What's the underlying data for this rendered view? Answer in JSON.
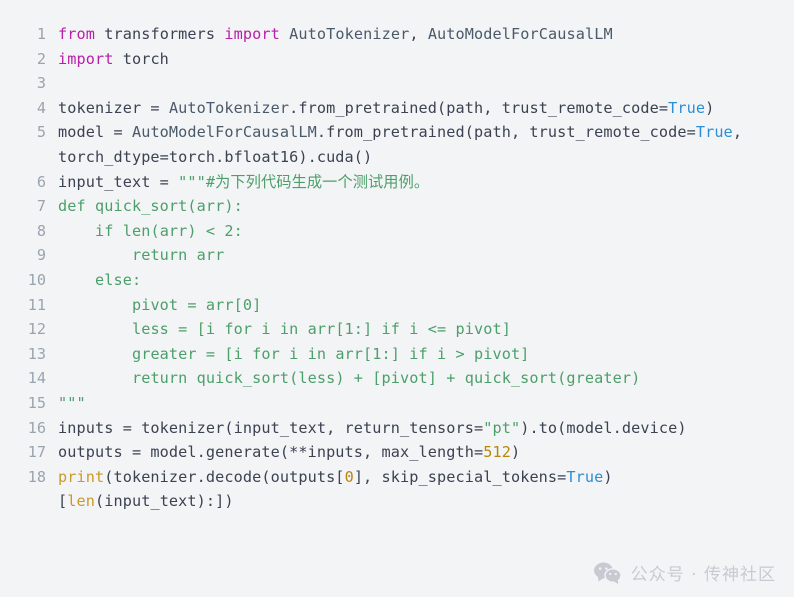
{
  "editor": {
    "language": "python",
    "background_color": "#f3f4f6",
    "gutter_color": "#9aa4ae",
    "default_text_color": "#3b4252",
    "colors": {
      "keyword": "#b820a8",
      "identifier": "#4a5a6a",
      "constant": "#2a8fd4",
      "string": "#4c9f6a",
      "number": "#b8860b",
      "builtin": "#ca9a24"
    },
    "lines": [
      {
        "number": "1",
        "text": "from transformers import AutoTokenizer, AutoModelForCausalLM"
      },
      {
        "number": "2",
        "text": "import torch"
      },
      {
        "number": "3",
        "text": ""
      },
      {
        "number": "4",
        "text": "tokenizer = AutoTokenizer.from_pretrained(path, trust_remote_code=True)"
      },
      {
        "number": "5",
        "text": "model = AutoModelForCausalLM.from_pretrained(path, trust_remote_code=True, torch_dtype=torch.bfloat16).cuda()"
      },
      {
        "number": "6",
        "text": "input_text = \"\"\"#为下列代码生成一个测试用例。"
      },
      {
        "number": "7",
        "text": "def quick_sort(arr):"
      },
      {
        "number": "8",
        "text": "    if len(arr) < 2:"
      },
      {
        "number": "9",
        "text": "        return arr"
      },
      {
        "number": "10",
        "text": "    else:"
      },
      {
        "number": "11",
        "text": "        pivot = arr[0]"
      },
      {
        "number": "12",
        "text": "        less = [i for i in arr[1:] if i <= pivot]"
      },
      {
        "number": "13",
        "text": "        greater = [i for i in arr[1:] if i > pivot]"
      },
      {
        "number": "14",
        "text": "        return quick_sort(less) + [pivot] + quick_sort(greater)"
      },
      {
        "number": "15",
        "text": "\"\"\""
      },
      {
        "number": "16",
        "text": "inputs = tokenizer(input_text, return_tensors=\"pt\").to(model.device)"
      },
      {
        "number": "17",
        "text": "outputs = model.generate(**inputs, max_length=512)"
      },
      {
        "number": "18",
        "text": "print(tokenizer.decode(outputs[0], skip_special_tokens=True)[len(input_text):])"
      }
    ]
  },
  "watermark": {
    "icon": "wechat-icon",
    "text": "公众号 · 传神社区",
    "color": "#c7cbd1"
  }
}
